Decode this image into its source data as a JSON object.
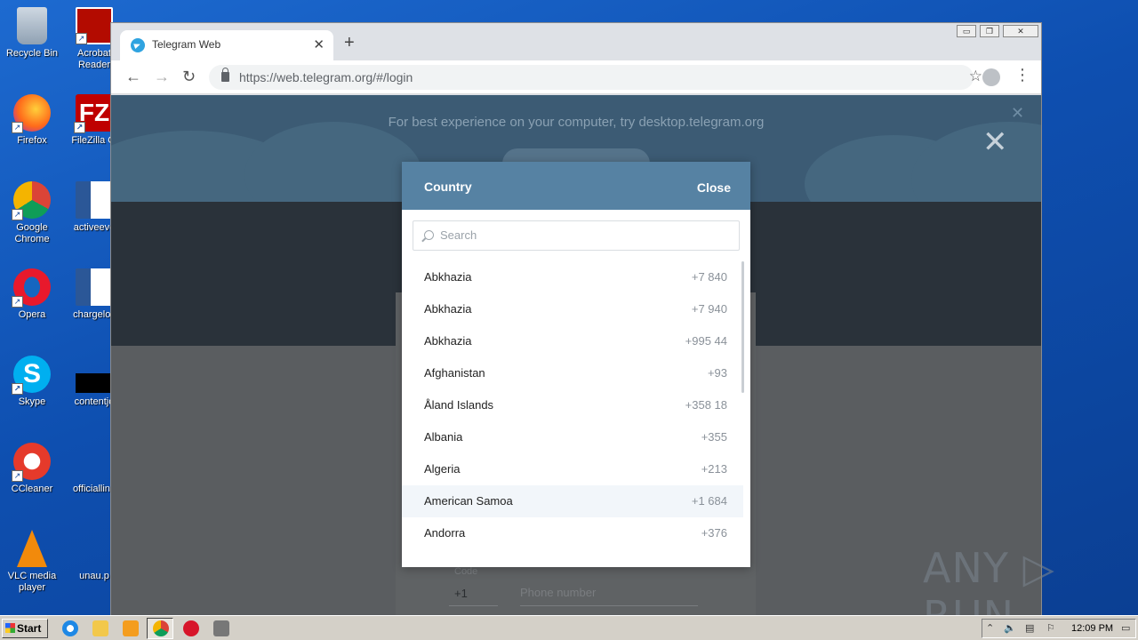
{
  "desktop": {
    "icons": [
      {
        "label": "Recycle Bin"
      },
      {
        "label": "Acrobat Reader"
      },
      {
        "label": "Firefox"
      },
      {
        "label": "FileZilla Cl"
      },
      {
        "label": "Google Chrome"
      },
      {
        "label": "activeeve"
      },
      {
        "label": "Opera"
      },
      {
        "label": "chargeloc"
      },
      {
        "label": "Skype"
      },
      {
        "label": "contentjo"
      },
      {
        "label": "CCleaner"
      },
      {
        "label": "officialline"
      },
      {
        "label": "VLC media player"
      },
      {
        "label": "unau.p"
      }
    ]
  },
  "browser": {
    "tab_title": "Telegram Web",
    "tab_close": "✕",
    "new_tab": "+",
    "url": "https://web.telegram.org/#/login",
    "window_buttons": [
      "▭",
      "❐",
      "✕"
    ]
  },
  "page": {
    "banner_text": "For best experience on your computer, try desktop.telegram.org",
    "banner_close": "✕",
    "big_close": "✕",
    "code_label": "Code",
    "code_value": "+1",
    "phone_placeholder": "Phone number"
  },
  "modal": {
    "title": "Country",
    "close_label": "Close",
    "search_placeholder": "Search",
    "countries": [
      {
        "name": "Abkhazia",
        "code": "+7 840"
      },
      {
        "name": "Abkhazia",
        "code": "+7 940"
      },
      {
        "name": "Abkhazia",
        "code": "+995 44"
      },
      {
        "name": "Afghanistan",
        "code": "+93"
      },
      {
        "name": "Åland Islands",
        "code": "+358 18"
      },
      {
        "name": "Albania",
        "code": "+355"
      },
      {
        "name": "Algeria",
        "code": "+213"
      },
      {
        "name": "American Samoa",
        "code": "+1 684"
      },
      {
        "name": "Andorra",
        "code": "+376"
      }
    ],
    "highlighted_index": 7
  },
  "watermark": "ANY ▷ RUN",
  "taskbar": {
    "start_label": "Start",
    "clock": "12:09 PM"
  },
  "colors": {
    "modal_header": "#5682a3",
    "telegram_blue": "#2fa3e0"
  }
}
